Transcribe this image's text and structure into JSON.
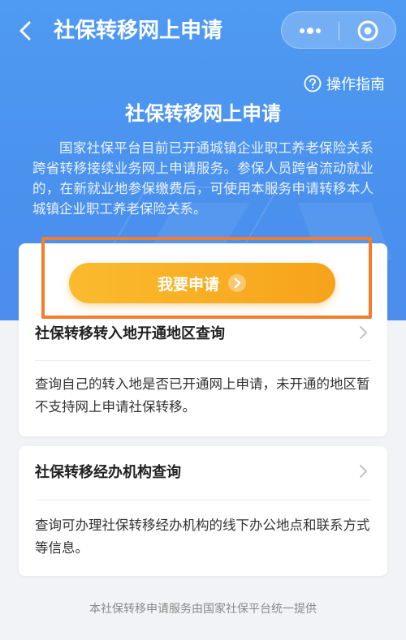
{
  "navbar": {
    "title": "社保转移网上申请"
  },
  "guide": {
    "label": "操作指南"
  },
  "hero": {
    "title": "社保转移网上申请",
    "description": "国家社保平台目前已开通城镇企业职工养老保险关系跨省转移接续业务网上申请服务。参保人员跨省流动就业的，在新就业地参保缴费后，可使用本服务申请转移本人城镇企业职工养老保险关系。"
  },
  "apply": {
    "label": "我要申请"
  },
  "query_areas": {
    "title": "社保转移转入地开通地区查询",
    "description": "查询自己的转入地是否已开通网上申请，未开通的地区暂不支持网上申请社保转移。"
  },
  "query_agencies": {
    "title": "社保转移经办机构查询",
    "description": "查询可办理社保转移经办机构的线下办公地点和联系方式等信息。"
  },
  "footer": {
    "text": "本社保转移申请服务由国家社保平台统一提供"
  },
  "colors": {
    "primary_blue": "#4a92ee",
    "button_orange": "#f6a31b",
    "highlight_orange": "#f57c2a"
  },
  "icons": [
    "back-arrow-icon",
    "more-dots-icon",
    "target-icon",
    "question-circle-icon",
    "chevron-right-icon"
  ]
}
